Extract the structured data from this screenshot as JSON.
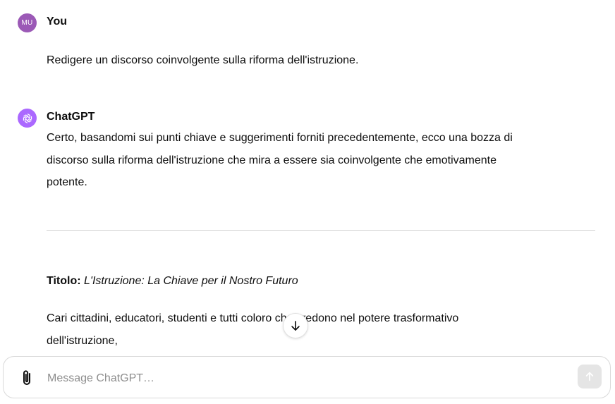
{
  "user_message": {
    "avatar_initials": "MU",
    "author": "You",
    "text": "Redigere un discorso coinvolgente sulla riforma dell'istruzione."
  },
  "assistant_message": {
    "author": "ChatGPT",
    "intro_lines": [
      "Certo, basandomi sui punti chiave e suggerimenti forniti precedentemente, ecco una bozza di",
      "discorso sulla riforma dell'istruzione che mira a essere sia coinvolgente che emotivamente",
      "potente."
    ],
    "title_label": "Titolo:",
    "title_text": "L'Istruzione: La Chiave per il Nostro Futuro",
    "body_lines": [
      "Cari cittadini, educatori, studenti e tutti coloro che credono nel potere trasformativo",
      "dell'istruzione,"
    ]
  },
  "composer": {
    "placeholder": "Message ChatGPT…"
  },
  "icons": {
    "scroll_down": "arrow-down-icon",
    "attach": "paperclip-icon",
    "send": "arrow-up-icon",
    "assistant_logo": "openai-logo-icon"
  },
  "colors": {
    "user_avatar": "#9b59b6",
    "assistant_avatar": "#ab68ff",
    "send_disabled": "#e5e5e5"
  }
}
